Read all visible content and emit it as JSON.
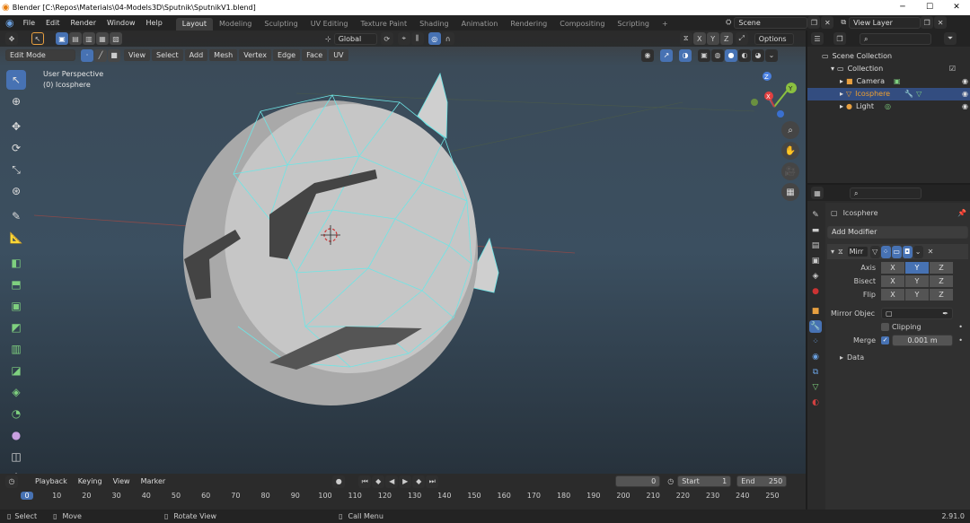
{
  "titlebar": {
    "title": "Blender [C:\\Repos\\Materials\\04-Models3D\\Sputnik\\SputnikV1.blend]",
    "min": "─",
    "max": "☐",
    "close": "✕"
  },
  "menu": [
    "File",
    "Edit",
    "Render",
    "Window",
    "Help"
  ],
  "workspaces": [
    "Layout",
    "Modeling",
    "Sculpting",
    "UV Editing",
    "Texture Paint",
    "Shading",
    "Animation",
    "Rendering",
    "Compositing",
    "Scripting"
  ],
  "workspace_add": "+",
  "scene": {
    "value": "Scene",
    "view_layer": "View Layer"
  },
  "toolbar": {
    "orientation": "Global",
    "options": "Options",
    "axes": [
      "X",
      "Y",
      "Z"
    ]
  },
  "header": {
    "mode": "Edit Mode",
    "menus": [
      "View",
      "Select",
      "Add",
      "Mesh",
      "Vertex",
      "Edge",
      "Face",
      "UV"
    ]
  },
  "viewport": {
    "perspective": "User Perspective",
    "object": "(0) Icosphere",
    "gizmo_x": "X",
    "gizmo_y": "Y",
    "gizmo_z": "Z"
  },
  "outliner": {
    "root": "Scene Collection",
    "collection": "Collection",
    "items": [
      {
        "label": "Camera",
        "selected": false
      },
      {
        "label": "Icosphere",
        "selected": true
      },
      {
        "label": "Light",
        "selected": false
      }
    ]
  },
  "properties": {
    "object_name": "Icosphere",
    "add_modifier": "Add Modifier",
    "modifier_name": "Mirr",
    "axis_label": "Axis",
    "bisect_label": "Bisect",
    "flip_label": "Flip",
    "xyz": [
      "X",
      "Y",
      "Z"
    ],
    "axis_active": "Y",
    "mirror_object_label": "Mirror Objec",
    "clipping_label": "Clipping",
    "merge_label": "Merge",
    "merge_value": "0.001 m",
    "data_label": "Data"
  },
  "timeline": {
    "menus": [
      "Playback",
      "Keying",
      "View",
      "Marker"
    ],
    "current_frame": "0",
    "start_label": "Start",
    "start": "1",
    "end_label": "End",
    "end": "250",
    "ticks": [
      "0",
      "10",
      "20",
      "30",
      "40",
      "50",
      "60",
      "70",
      "80",
      "90",
      "100",
      "110",
      "120",
      "130",
      "140",
      "150",
      "160",
      "170",
      "180",
      "190",
      "200",
      "210",
      "220",
      "230",
      "240",
      "250"
    ]
  },
  "status": {
    "select": "Select",
    "move": "Move",
    "rotate": "Rotate View",
    "call_menu": "Call Menu",
    "version": "2.91.0"
  },
  "colors": {
    "accent": "#4772b3",
    "active_object": "#f0a030",
    "wire": "#6ee6e6"
  }
}
